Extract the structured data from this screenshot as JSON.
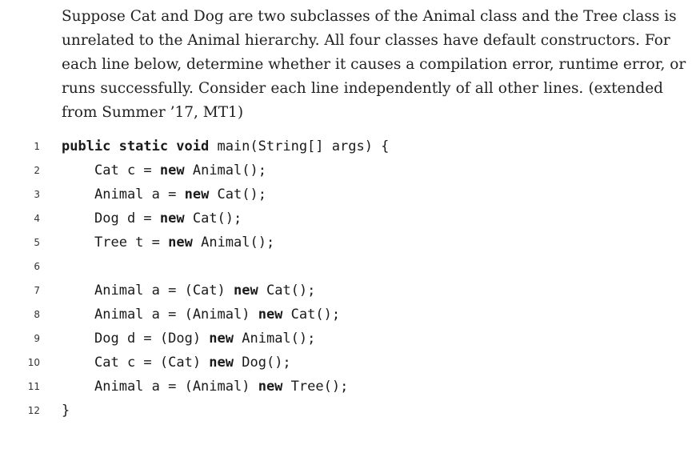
{
  "prose": {
    "lines": [
      "Suppose Cat and Dog are two subclasses of the Animal class and the Tree class is",
      "unrelated to the Animal hierarchy.  All four classes have default constructors.  For",
      "each line below, determine whether it causes a compilation error, runtime error, or",
      "runs successfully.  Consider each line independently of all other lines.  (extended",
      "from Summer ’17, MT1)"
    ]
  },
  "code": {
    "lines": [
      {
        "num": "1",
        "parts": [
          {
            "t": "public static void",
            "kw": true
          },
          {
            "t": " main(String[] args) {",
            "kw": false
          }
        ]
      },
      {
        "num": "2",
        "parts": [
          {
            "t": "Cat c = ",
            "kw": false
          },
          {
            "t": "new",
            "kw": true
          },
          {
            "t": " Animal();",
            "kw": false
          }
        ]
      },
      {
        "num": "3",
        "parts": [
          {
            "t": "Animal a = ",
            "kw": false
          },
          {
            "t": "new",
            "kw": true
          },
          {
            "t": " Cat();",
            "kw": false
          }
        ]
      },
      {
        "num": "4",
        "parts": [
          {
            "t": "Dog d = ",
            "kw": false
          },
          {
            "t": "new",
            "kw": true
          },
          {
            "t": " Cat();",
            "kw": false
          }
        ]
      },
      {
        "num": "5",
        "parts": [
          {
            "t": "Tree t = ",
            "kw": false
          },
          {
            "t": "new",
            "kw": true
          },
          {
            "t": " Animal();",
            "kw": false
          }
        ]
      },
      {
        "num": "6",
        "parts": []
      },
      {
        "num": "7",
        "parts": [
          {
            "t": "Animal a = (Cat) ",
            "kw": false
          },
          {
            "t": "new",
            "kw": true
          },
          {
            "t": " Cat();",
            "kw": false
          }
        ]
      },
      {
        "num": "8",
        "parts": [
          {
            "t": "Animal a = (Animal) ",
            "kw": false
          },
          {
            "t": "new",
            "kw": true
          },
          {
            "t": " Cat();",
            "kw": false
          }
        ]
      },
      {
        "num": "9",
        "parts": [
          {
            "t": "Dog d = (Dog) ",
            "kw": false
          },
          {
            "t": "new",
            "kw": true
          },
          {
            "t": " Animal();",
            "kw": false
          }
        ]
      },
      {
        "num": "10",
        "parts": [
          {
            "t": "Cat c = (Cat) ",
            "kw": false
          },
          {
            "t": "new",
            "kw": true
          },
          {
            "t": " Dog();",
            "kw": false
          }
        ]
      },
      {
        "num": "11",
        "parts": [
          {
            "t": "Animal a = (Animal) ",
            "kw": false
          },
          {
            "t": "new",
            "kw": true
          },
          {
            "t": " Tree();",
            "kw": false
          }
        ]
      },
      {
        "num": "12",
        "parts": [
          {
            "t": "}",
            "kw": false
          }
        ]
      }
    ]
  }
}
